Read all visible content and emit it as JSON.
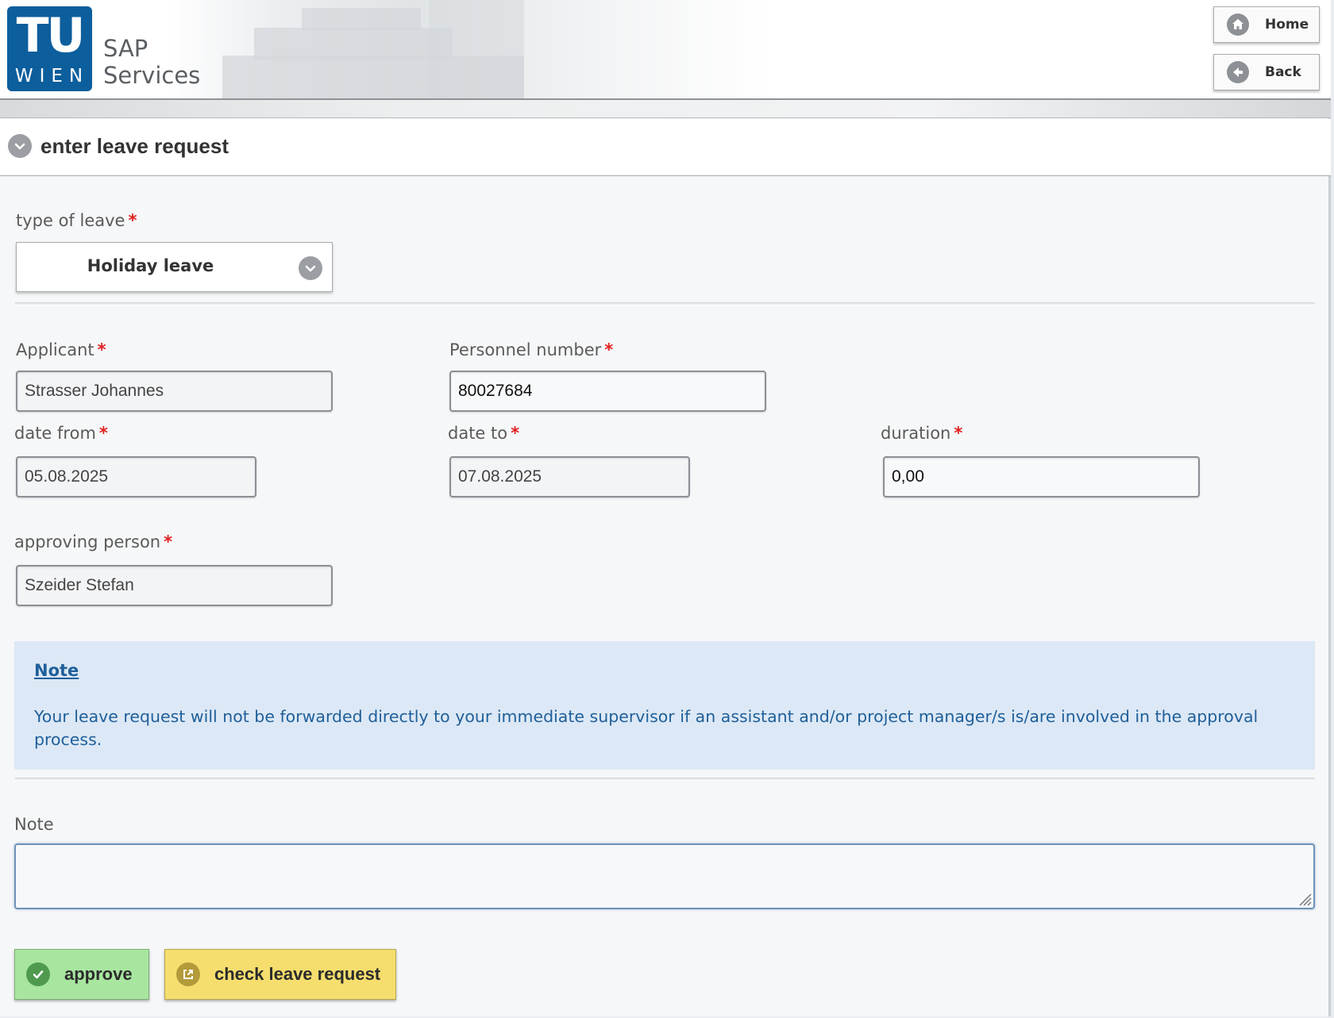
{
  "header": {
    "logo_tu": "TU",
    "logo_wien": "WIEN",
    "app_title_line1": "SAP",
    "app_title_line2": "Services",
    "home_label": "Home",
    "back_label": "Back"
  },
  "section": {
    "title": "enter leave request"
  },
  "form": {
    "type_of_leave": {
      "label": "type of leave",
      "value": "Holiday leave",
      "required_mark": "*"
    },
    "applicant": {
      "label": "Applicant",
      "value": "Strasser Johannes",
      "required_mark": "*"
    },
    "personnel_number": {
      "label": "Personnel number",
      "value": "80027684",
      "required_mark": "*"
    },
    "date_from": {
      "label": "date from",
      "value": "05.08.2025",
      "required_mark": "*"
    },
    "date_to": {
      "label": "date to",
      "value": "07.08.2025",
      "required_mark": "*"
    },
    "duration": {
      "label": "duration",
      "value": "0,00",
      "required_mark": "*"
    },
    "approving_person": {
      "label": "approving person",
      "value": "Szeider Stefan",
      "required_mark": "*"
    },
    "note_field": {
      "label": "Note",
      "value": ""
    }
  },
  "info_note": {
    "title": "Note",
    "text": "Your leave request will not be forwarded directly to your immediate supervisor if an assistant and/or project manager/s is/are involved in the approval process."
  },
  "actions": {
    "approve_label": "approve",
    "check_label": "check leave request"
  },
  "colors": {
    "brand_blue": "#0d5e9c",
    "required": "#e02020",
    "note_bg": "#dce8f5",
    "note_text": "#1f5f9a",
    "approve_bg": "#a8e6a0",
    "check_bg": "#f5de6e"
  },
  "icons": {
    "home": "home-icon",
    "back": "arrow-left-icon",
    "section_toggle": "chevron-down-icon",
    "select_toggle": "chevron-down-icon",
    "approve": "checkmark-icon",
    "check": "external-link-icon",
    "resize": "resize-grip-icon"
  }
}
